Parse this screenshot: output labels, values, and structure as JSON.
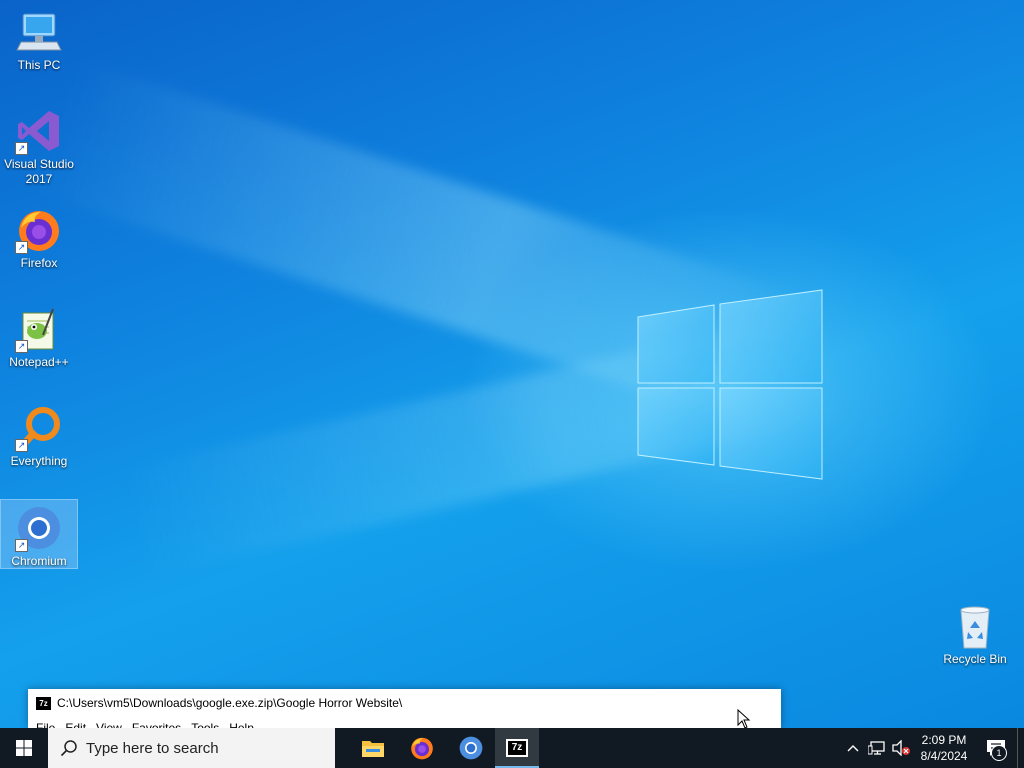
{
  "desktop": {
    "icons": [
      {
        "label": "This PC",
        "icon": "this-pc-icon"
      },
      {
        "label": "Visual Studio 2017",
        "icon": "visual-studio-icon"
      },
      {
        "label": "Firefox",
        "icon": "firefox-icon"
      },
      {
        "label": "Notepad++",
        "icon": "notepad-plus-plus-icon"
      },
      {
        "label": "Everything",
        "icon": "everything-search-icon"
      },
      {
        "label": "Chromium",
        "icon": "chromium-icon",
        "selected": true
      },
      {
        "label": "Recycle Bin",
        "icon": "recycle-bin-icon"
      }
    ]
  },
  "window": {
    "app_icon_text": "7z",
    "title": "C:\\Users\\vm5\\Downloads\\google.exe.zip\\Google Horror Website\\",
    "menu": [
      "File",
      "Edit",
      "View",
      "Favorites",
      "Tools",
      "Help"
    ]
  },
  "taskbar": {
    "search_placeholder": "Type here to search",
    "apps": [
      {
        "name": "File Explorer",
        "icon": "file-explorer-icon"
      },
      {
        "name": "Firefox",
        "icon": "firefox-icon"
      },
      {
        "name": "Chromium",
        "icon": "chromium-icon"
      },
      {
        "name": "7-Zip",
        "icon": "7zip-icon",
        "active": true,
        "label": "7z"
      }
    ],
    "clock": {
      "time": "2:09 PM",
      "date": "8/4/2024"
    },
    "notification_count": "1"
  },
  "colors": {
    "accent": "#76b9ed",
    "taskbar": "#111a22",
    "desktop": "#0e7fdd"
  }
}
